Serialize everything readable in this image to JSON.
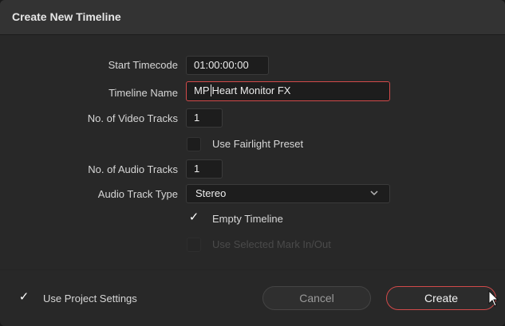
{
  "dialog": {
    "title": "Create New Timeline"
  },
  "form": {
    "start_timecode_label": "Start Timecode",
    "start_timecode_value": "01:00:00:00",
    "timeline_name_label": "Timeline Name",
    "timeline_name_before_caret": "MP",
    "timeline_name_after_caret": "Heart Monitor FX",
    "video_tracks_label": "No. of Video Tracks",
    "video_tracks_value": "1",
    "fairlight_label": "Use Fairlight Preset",
    "fairlight_checked": false,
    "audio_tracks_label": "No. of Audio Tracks",
    "audio_tracks_value": "1",
    "audio_type_label": "Audio Track Type",
    "audio_type_value": "Stereo",
    "empty_timeline_label": "Empty Timeline",
    "empty_timeline_checked": true,
    "check_mark": "✓",
    "selected_mark_label": "Use Selected Mark In/Out",
    "selected_mark_enabled": false
  },
  "footer": {
    "project_settings_label": "Use Project Settings",
    "project_settings_checked": true,
    "cancel_label": "Cancel",
    "create_label": "Create"
  },
  "colors": {
    "accent": "#d24a4a",
    "background": "#282828",
    "titlebar": "#333333",
    "field": "#1d1d1d"
  },
  "icons": {
    "audio_type_dropdown": "chevron-down-icon",
    "mouse": "cursor-arrow-icon"
  }
}
